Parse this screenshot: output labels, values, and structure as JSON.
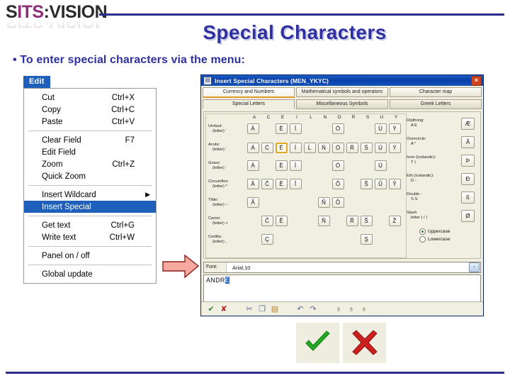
{
  "slide": {
    "logo": {
      "part1": "S",
      "part2": "ITS",
      "part3": ":VISION"
    },
    "title": "Special Characters",
    "bullet_marker": "•",
    "bullet": "To enter special characters via the menu:"
  },
  "menu": {
    "title": "Edit",
    "groups": [
      [
        {
          "label": "Cut",
          "accel": "Ctrl+X"
        },
        {
          "label": "Copy",
          "accel": "Ctrl+C"
        },
        {
          "label": "Paste",
          "accel": "Ctrl+V"
        }
      ],
      [
        {
          "label": "Clear Field",
          "accel": "F7"
        },
        {
          "label": "Edit Field",
          "accel": ""
        },
        {
          "label": "Zoom",
          "accel": "Ctrl+Z"
        },
        {
          "label": "Quick Zoom",
          "accel": ""
        }
      ],
      [
        {
          "label": "Insert Wildcard",
          "accel": "",
          "submenu": "▶"
        },
        {
          "label": "Insert Special",
          "accel": "",
          "selected": true
        }
      ],
      [
        {
          "label": "Get text",
          "accel": "Ctrl+G"
        },
        {
          "label": "Write text",
          "accel": "Ctrl+W"
        }
      ],
      [
        {
          "label": "Panel on / off",
          "accel": ""
        }
      ],
      [
        {
          "label": "Global update",
          "accel": ""
        }
      ]
    ]
  },
  "dialog": {
    "icon": "window-icon",
    "title": "Insert Special Characters (MEN_YKYC)",
    "close_label": "×",
    "tabs_row1": [
      {
        "label": "Currency and Numbers",
        "active": true
      },
      {
        "label": "Mathematical symbols and operators",
        "active": false
      },
      {
        "label": "Character map",
        "active": false
      }
    ],
    "tabs_row2": [
      {
        "label": "Special Letters",
        "active": true
      },
      {
        "label": "Miscellaneous Symbols",
        "active": false
      },
      {
        "label": "Greek Letters",
        "active": false
      }
    ],
    "grid": {
      "columns": [
        "A",
        "C",
        "E",
        "I",
        "L",
        "N",
        "O",
        "R",
        "S",
        "U",
        "Y"
      ],
      "rows": [
        {
          "label_line1": "Umlaut:",
          "label_line2": "(letter) ¨",
          "cells": [
            "Ä",
            "",
            "Ë",
            "Ï",
            "",
            "",
            "Ö",
            "",
            "",
            "Ü",
            "Ÿ"
          ]
        },
        {
          "label_line1": "Acute:",
          "label_line2": "(letter) '",
          "cells": [
            "Á",
            "Ć",
            "É",
            "Í",
            "Ĺ",
            "Ń",
            "Ó",
            "Ŕ",
            "Ś",
            "Ú",
            "Ý"
          ],
          "highlight": 2
        },
        {
          "label_line1": "Grave:",
          "label_line2": "(letter) `",
          "cells": [
            "À",
            "",
            "È",
            "Ì",
            "",
            "",
            "Ò",
            "",
            "",
            "Ù",
            ""
          ]
        },
        {
          "label_line1": "Circumflex:",
          "label_line2": "(letter) ^",
          "cells": [
            "Â",
            "Ĉ",
            "Ê",
            "Î",
            "",
            "",
            "Ô",
            "",
            "Ŝ",
            "Û",
            "Ŷ"
          ]
        },
        {
          "label_line1": "Tilde:",
          "label_line2": "(letter) ~",
          "cells": [
            "Ã",
            "",
            "",
            "",
            "",
            "Ñ",
            "Õ",
            "",
            "",
            "",
            ""
          ]
        },
        {
          "label_line1": "Caron:",
          "label_line2": "(letter) <",
          "cells": [
            "",
            "Č",
            "Ě",
            "",
            "",
            "Ň",
            "",
            "Ř",
            "Š",
            "",
            "Ž"
          ]
        },
        {
          "label_line1": "Cedilla:",
          "label_line2": "(letter) ,",
          "cells": [
            "",
            "Ç",
            "",
            "",
            "",
            "",
            "",
            "",
            "Ş",
            "",
            ""
          ]
        }
      ]
    },
    "side_items": [
      {
        "label_line1": "Dipthong:",
        "label_line2": "A E",
        "key": "Æ"
      },
      {
        "label_line1": "Overcircle:",
        "label_line2": "A °",
        "key": "Å"
      },
      {
        "label_line1": "horn (Icelandic):",
        "label_line2": "T )",
        "key": "Þ"
      },
      {
        "label_line1": "Eth (Icelandic):",
        "label_line2": "D -",
        "key": "Ð"
      },
      {
        "label_line1": "Double -",
        "label_line2": "S S",
        "key": "ß"
      },
      {
        "label_line1": "Slash",
        "label_line2": "letter ( / )",
        "key": "Ø"
      }
    ],
    "case_options": [
      {
        "label": "Uppercase",
        "selected": true
      },
      {
        "label": "Lowercase",
        "selected": false
      }
    ],
    "font_label": "Font:",
    "font_value": "Arial,10",
    "font_dropdown_icon": "⌄",
    "text_value": "ANDR",
    "text_selected_char": "É",
    "toolbar": [
      {
        "name": "accept-icon",
        "glyph": "✔",
        "color": "#2d8a2d"
      },
      {
        "name": "cancel-icon",
        "glyph": "✘",
        "color": "#b52020"
      },
      {
        "name": "cut-icon",
        "glyph": "✂",
        "color": "#5a6a8a"
      },
      {
        "name": "copy-icon",
        "glyph": "❐",
        "color": "#5a7a9a"
      },
      {
        "name": "paste-icon",
        "glyph": "▤",
        "color": "#b5862a"
      },
      {
        "name": "undo-icon",
        "glyph": "↶",
        "color": "#5a6a8a"
      },
      {
        "name": "redo-icon",
        "glyph": "↷",
        "color": "#5a6a8a"
      },
      {
        "name": "find-icon",
        "glyph": "♁",
        "color": "#5a4a2a"
      },
      {
        "name": "find-next-icon",
        "glyph": "♁",
        "color": "#5a4a2a"
      },
      {
        "name": "find-prev-icon",
        "glyph": "♁",
        "color": "#5a4a2a"
      }
    ]
  },
  "footer_icons": [
    {
      "name": "big-accept-icon",
      "glyph": "✔",
      "color": "#22aa22"
    },
    {
      "name": "big-cancel-icon",
      "glyph": "✖",
      "color": "#cc2020"
    }
  ],
  "colors": {
    "accent_blue": "#2f31a0",
    "title_blue": "#0a3fa8",
    "highlight_orange": "#e0a924",
    "arrow_pink": "#f7a9a0"
  }
}
